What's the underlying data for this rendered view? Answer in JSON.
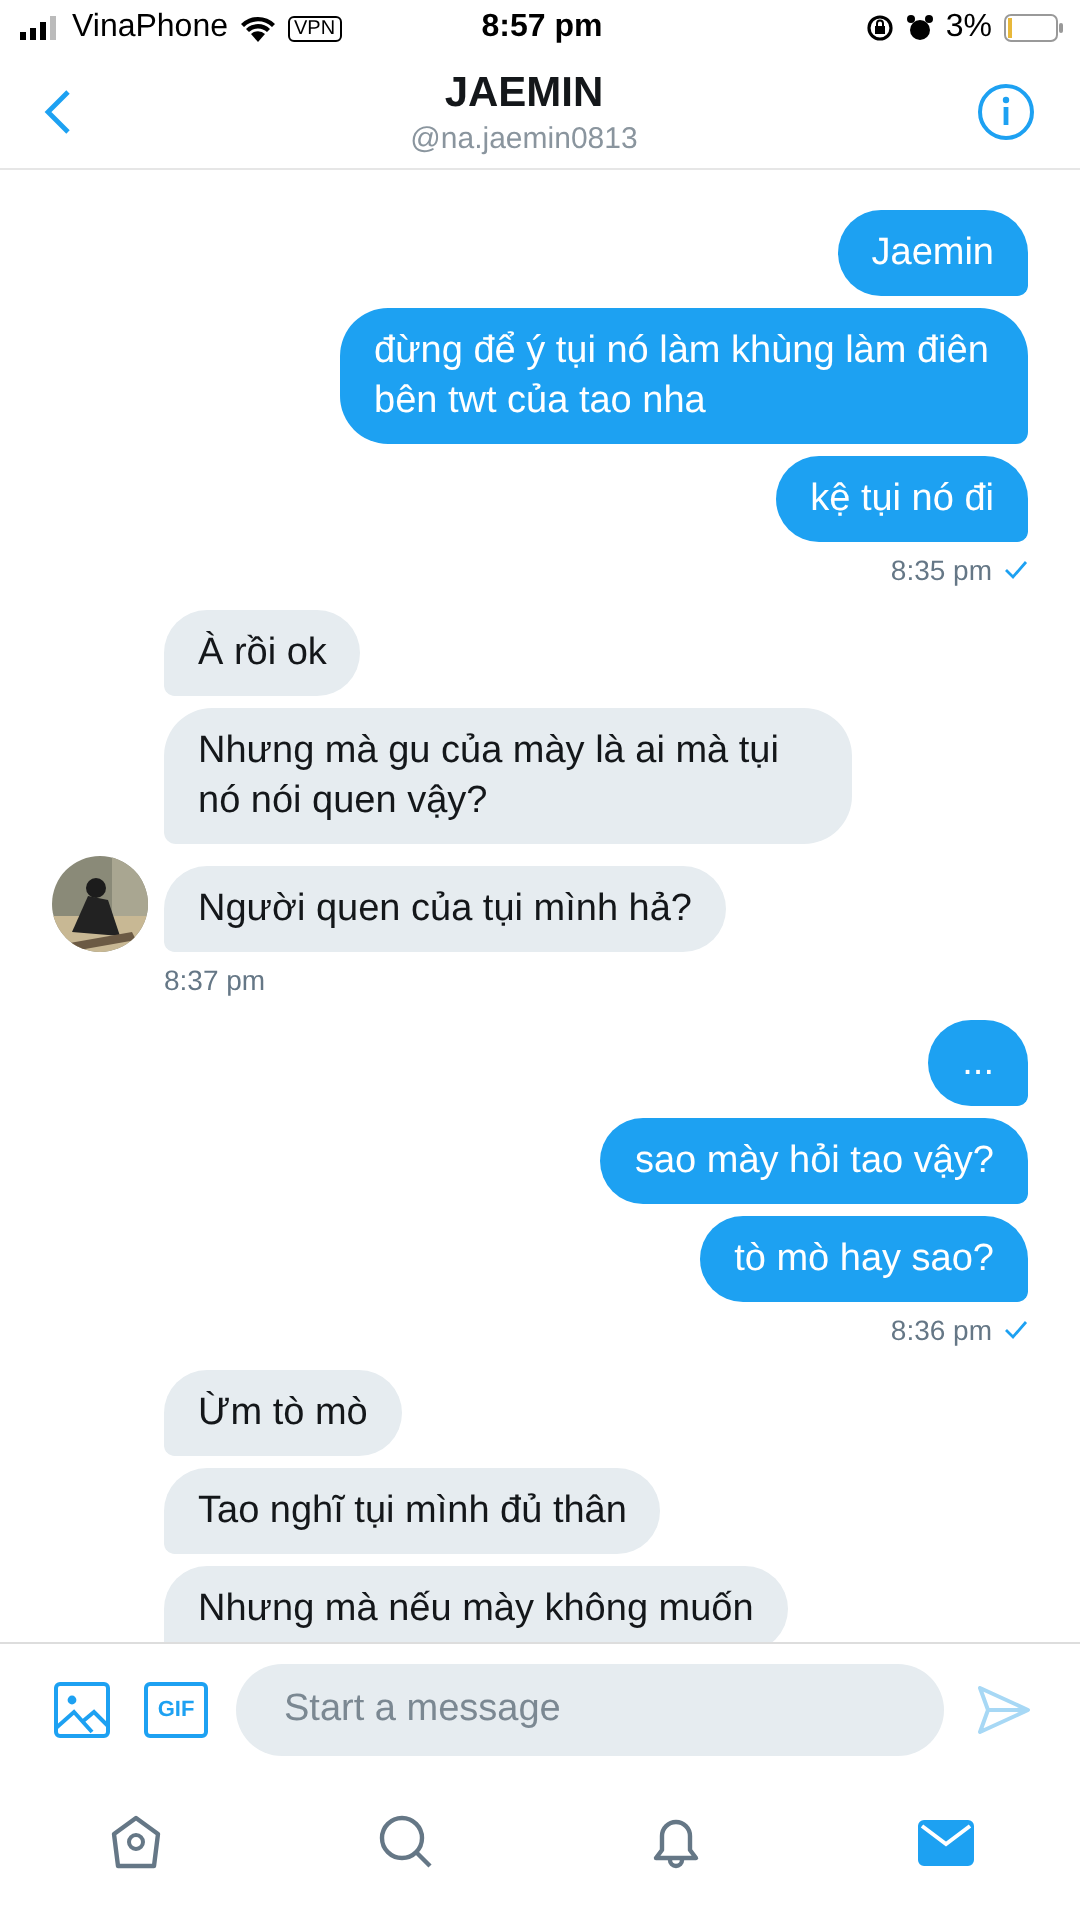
{
  "status_bar": {
    "carrier": "VinaPhone",
    "vpn": "VPN",
    "time": "8:57 pm",
    "battery": "3%"
  },
  "header": {
    "name": "JAEMIN",
    "handle": "@na.jaemin0813"
  },
  "groups": [
    {
      "kind": "outgoing",
      "messages": [
        "Jaemin",
        "đừng để ý tụi nó làm khùng làm điên bên twt của tao nha",
        "kệ tụi nó đi"
      ],
      "time": "8:35 pm",
      "read": true
    },
    {
      "kind": "incoming",
      "messages": [
        "À rồi ok",
        "Nhưng mà gu của mày là ai mà tụi nó nói quen vậy?",
        "Người quen của tụi mình hả?"
      ],
      "time": "8:37 pm"
    },
    {
      "kind": "outgoing",
      "messages": [
        "...",
        "sao mày hỏi tao vậy?",
        "tò mò hay sao?"
      ],
      "time": "8:36 pm",
      "read": true
    },
    {
      "kind": "incoming",
      "messages": [
        "Ừm tò mò",
        "Tao nghĩ tụi mình đủ thân",
        "Nhưng mà nếu mày không muốn"
      ]
    }
  ],
  "composer": {
    "gif": "GIF",
    "placeholder": "Start a message"
  },
  "tabs": [
    {
      "kind": "home",
      "selected": false
    },
    {
      "kind": "search",
      "selected": false
    },
    {
      "kind": "notifications",
      "selected": false
    },
    {
      "kind": "messages",
      "selected": true
    }
  ]
}
